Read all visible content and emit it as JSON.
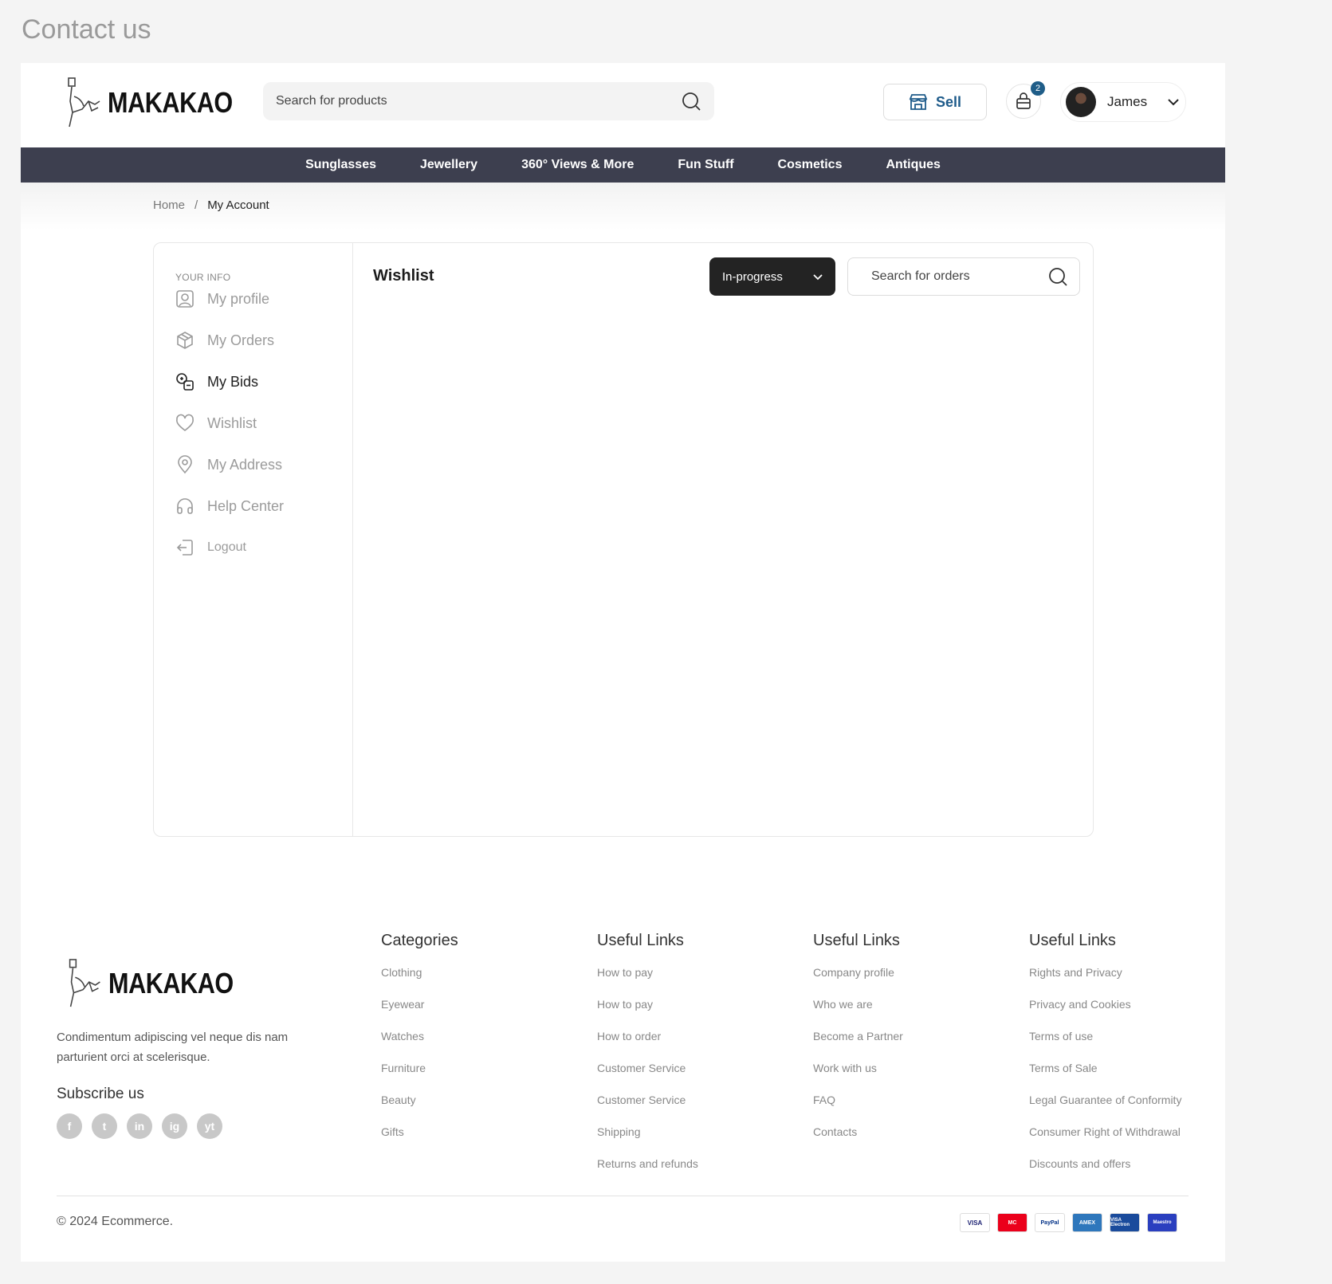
{
  "frame_title": "Contact us",
  "header": {
    "logo_text": "MAKAKAO",
    "search_placeholder": "Search for products",
    "sell_label": "Sell",
    "cart_count": "2",
    "user_name": "James"
  },
  "nav": [
    "Sunglasses",
    "Jewellery",
    "360° Views & More",
    "Fun Stuff",
    "Cosmetics",
    "Antiques"
  ],
  "breadcrumb": {
    "home": "Home",
    "separator": "/",
    "current": "My Account"
  },
  "sidebar": {
    "heading": "YOUR INFO",
    "items": [
      {
        "label": "My profile",
        "icon": "user-icon"
      },
      {
        "label": "My Orders",
        "icon": "box-icon"
      },
      {
        "label": "My Bids",
        "icon": "bids-icon",
        "active": true
      },
      {
        "label": "Wishlist",
        "icon": "heart-icon"
      },
      {
        "label": "My Address",
        "icon": "location-icon"
      },
      {
        "label": "Help Center",
        "icon": "headphones-icon"
      },
      {
        "label": "Logout",
        "icon": "logout-icon"
      }
    ]
  },
  "main": {
    "title": "Wishlist",
    "status_value": "In-progress",
    "order_search_placeholder": "Search for orders"
  },
  "footer": {
    "logo_text": "MAKAKAO",
    "description": "Condimentum adipiscing vel neque dis nam parturient orci at scelerisque.",
    "subscribe": "Subscribe us",
    "socials": [
      "f",
      "t",
      "in",
      "ig",
      "yt"
    ],
    "columns": [
      {
        "title": "Categories",
        "links": [
          "Clothing",
          "Eyewear",
          "Watches",
          "Furniture",
          "Beauty",
          "Gifts"
        ]
      },
      {
        "title": "Useful Links",
        "links": [
          "How to pay",
          "How to pay",
          "How to order",
          "Customer Service",
          "Customer Service",
          "Shipping",
          "Returns and refunds"
        ]
      },
      {
        "title": "Useful Links",
        "links": [
          "Company profile",
          "Who we are",
          "Become a Partner",
          "Work with us",
          "FAQ",
          "Contacts"
        ]
      },
      {
        "title": "Useful Links",
        "links": [
          "Rights and Privacy",
          "Privacy and Cookies",
          "Terms of use",
          "Terms of Sale",
          "Legal Guarantee of Conformity",
          "Consumer Right of Withdrawal",
          "Discounts and offers"
        ]
      }
    ],
    "copyright": "© 2024 Ecommerce.",
    "payments": [
      "VISA",
      "MC",
      "PayPal",
      "AMEX",
      "VISA Electron",
      "Maestro"
    ]
  },
  "colors": {
    "nav_bg": "#3d3f4f",
    "accent": "#1f5d88",
    "dark_button": "#232323"
  }
}
